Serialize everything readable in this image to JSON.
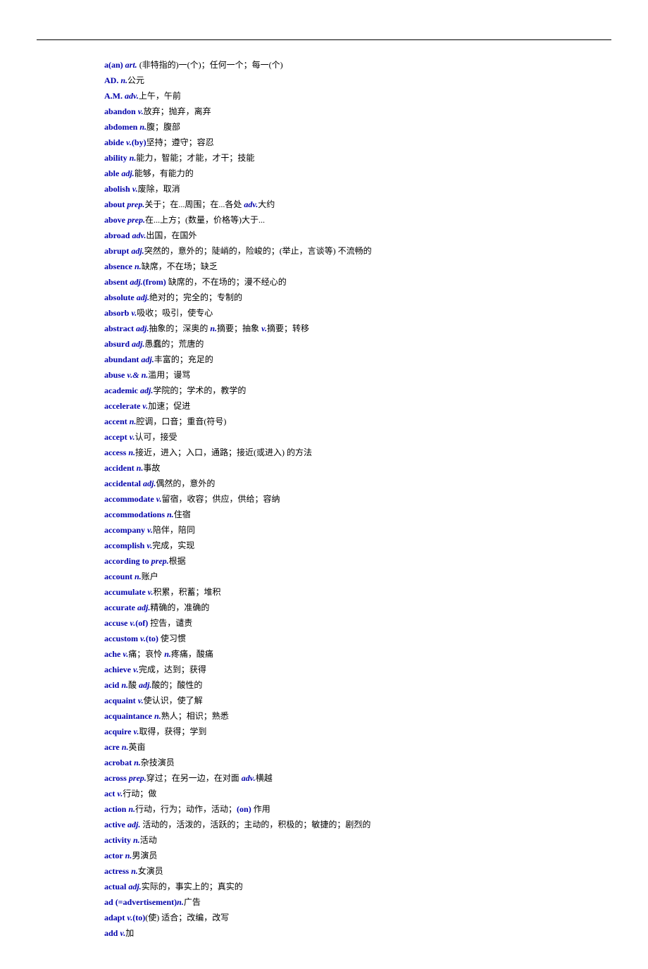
{
  "entries": [
    {
      "parts": [
        {
          "t": "hw",
          "v": "a(an)"
        },
        {
          "t": "sp"
        },
        {
          "t": "pos",
          "v": "art."
        },
        {
          "t": "sp"
        },
        {
          "t": "def",
          "v": "(非特指的)一(个)；任何一个；每一(个)"
        }
      ]
    },
    {
      "parts": [
        {
          "t": "hw",
          "v": "AD."
        },
        {
          "t": "sp"
        },
        {
          "t": "pos",
          "v": "n."
        },
        {
          "t": "def",
          "v": "公元"
        }
      ]
    },
    {
      "parts": [
        {
          "t": "hw",
          "v": "A.M."
        },
        {
          "t": "sp"
        },
        {
          "t": "pos",
          "v": "adv."
        },
        {
          "t": "def",
          "v": "上午，午前"
        }
      ]
    },
    {
      "parts": [
        {
          "t": "hw",
          "v": "abandon"
        },
        {
          "t": "sp"
        },
        {
          "t": "pos",
          "v": "v."
        },
        {
          "t": "def",
          "v": "放弃；抛弃，离弃"
        }
      ]
    },
    {
      "parts": [
        {
          "t": "hw",
          "v": "abdomen"
        },
        {
          "t": "sp"
        },
        {
          "t": "pos",
          "v": "n."
        },
        {
          "t": "def",
          "v": "腹；腹部"
        }
      ]
    },
    {
      "parts": [
        {
          "t": "hw",
          "v": "abide"
        },
        {
          "t": "sp"
        },
        {
          "t": "pos",
          "v": "v."
        },
        {
          "t": "hw",
          "v": "(by)"
        },
        {
          "t": "def",
          "v": "坚持；遵守；容忍"
        }
      ]
    },
    {
      "parts": [
        {
          "t": "hw",
          "v": "ability"
        },
        {
          "t": "sp"
        },
        {
          "t": "pos",
          "v": "n."
        },
        {
          "t": "def",
          "v": "能力，智能；才能，才干；技能"
        }
      ]
    },
    {
      "parts": [
        {
          "t": "hw",
          "v": "able"
        },
        {
          "t": "sp"
        },
        {
          "t": "pos",
          "v": "adj."
        },
        {
          "t": "def",
          "v": "能够，有能力的"
        }
      ]
    },
    {
      "parts": [
        {
          "t": "hw",
          "v": "abolish"
        },
        {
          "t": "sp"
        },
        {
          "t": "pos",
          "v": "v."
        },
        {
          "t": "def",
          "v": "废除，取消"
        }
      ]
    },
    {
      "parts": [
        {
          "t": "hw",
          "v": "about"
        },
        {
          "t": "sp"
        },
        {
          "t": "pos",
          "v": "prep."
        },
        {
          "t": "def",
          "v": "关于；在...周围；在...各处 "
        },
        {
          "t": "pos",
          "v": "adv."
        },
        {
          "t": "def",
          "v": "大约"
        }
      ]
    },
    {
      "parts": [
        {
          "t": "hw",
          "v": "above"
        },
        {
          "t": "sp"
        },
        {
          "t": "pos",
          "v": "prep."
        },
        {
          "t": "def",
          "v": "在...上方；(数量，价格等)大于..."
        }
      ]
    },
    {
      "parts": [
        {
          "t": "hw",
          "v": "abroad"
        },
        {
          "t": "sp"
        },
        {
          "t": "pos",
          "v": "adv."
        },
        {
          "t": "def",
          "v": "出国，在国外"
        }
      ]
    },
    {
      "parts": [
        {
          "t": "hw",
          "v": "abrupt"
        },
        {
          "t": "sp"
        },
        {
          "t": "pos",
          "v": "adj."
        },
        {
          "t": "def",
          "v": "突然的，意外的；陡峭的，险峻的；(举止，言谈等) 不流畅的"
        }
      ]
    },
    {
      "parts": [
        {
          "t": "hw",
          "v": "absence"
        },
        {
          "t": "sp"
        },
        {
          "t": "pos",
          "v": "n."
        },
        {
          "t": "def",
          "v": "缺席，不在场；缺乏"
        }
      ]
    },
    {
      "parts": [
        {
          "t": "hw",
          "v": "absent"
        },
        {
          "t": "sp"
        },
        {
          "t": "pos",
          "v": "adj."
        },
        {
          "t": "hw",
          "v": "(from)"
        },
        {
          "t": "def",
          "v": " 缺席的，不在场的；漫不经心的"
        }
      ]
    },
    {
      "parts": [
        {
          "t": "hw",
          "v": "absolute"
        },
        {
          "t": "sp"
        },
        {
          "t": "pos",
          "v": "adj."
        },
        {
          "t": "def",
          "v": "绝对的；完全的；专制的"
        }
      ]
    },
    {
      "parts": [
        {
          "t": "hw",
          "v": "absorb"
        },
        {
          "t": "sp"
        },
        {
          "t": "pos",
          "v": "v."
        },
        {
          "t": "def",
          "v": "吸收；吸引，使专心"
        }
      ]
    },
    {
      "parts": [
        {
          "t": "hw",
          "v": "abstract"
        },
        {
          "t": "sp"
        },
        {
          "t": "pos",
          "v": "adj."
        },
        {
          "t": "def",
          "v": "抽象的；深奥的 "
        },
        {
          "t": "pos",
          "v": "n."
        },
        {
          "t": "def",
          "v": "摘要；抽象 "
        },
        {
          "t": "pos",
          "v": "v."
        },
        {
          "t": "def",
          "v": "摘要；转移"
        }
      ]
    },
    {
      "parts": [
        {
          "t": "hw",
          "v": "absurd"
        },
        {
          "t": "sp"
        },
        {
          "t": "pos",
          "v": "adj."
        },
        {
          "t": "def",
          "v": "愚蠢的；荒唐的"
        }
      ]
    },
    {
      "parts": [
        {
          "t": "hw",
          "v": "abundant"
        },
        {
          "t": "sp"
        },
        {
          "t": "pos",
          "v": "adj."
        },
        {
          "t": "def",
          "v": "丰富的；充足的"
        }
      ]
    },
    {
      "parts": [
        {
          "t": "hw",
          "v": "abuse"
        },
        {
          "t": "sp"
        },
        {
          "t": "pos",
          "v": "v.&"
        },
        {
          "t": "sp"
        },
        {
          "t": "pos",
          "v": "n."
        },
        {
          "t": "def",
          "v": "滥用；谩骂"
        }
      ]
    },
    {
      "parts": [
        {
          "t": "hw",
          "v": "academic"
        },
        {
          "t": "sp"
        },
        {
          "t": "pos",
          "v": "adj."
        },
        {
          "t": "def",
          "v": "学院的；学术的，教学的"
        }
      ]
    },
    {
      "parts": [
        {
          "t": "hw",
          "v": "accelerate"
        },
        {
          "t": "sp"
        },
        {
          "t": "pos",
          "v": "v."
        },
        {
          "t": "def",
          "v": "加速；促进"
        }
      ]
    },
    {
      "parts": [
        {
          "t": "hw",
          "v": "accent"
        },
        {
          "t": "sp"
        },
        {
          "t": "pos",
          "v": "n."
        },
        {
          "t": "def",
          "v": "腔调，口音；重音(符号)"
        }
      ]
    },
    {
      "parts": [
        {
          "t": "hw",
          "v": "accept"
        },
        {
          "t": "sp"
        },
        {
          "t": "pos",
          "v": "v."
        },
        {
          "t": "def",
          "v": "认可，接受"
        }
      ]
    },
    {
      "parts": [
        {
          "t": "hw",
          "v": "access"
        },
        {
          "t": "sp"
        },
        {
          "t": "pos",
          "v": "n."
        },
        {
          "t": "def",
          "v": "接近，进入；入口，通路；接近(或进入) 的方法"
        }
      ]
    },
    {
      "parts": [
        {
          "t": "hw",
          "v": "accident"
        },
        {
          "t": "sp"
        },
        {
          "t": "pos",
          "v": "n."
        },
        {
          "t": "def",
          "v": "事故"
        }
      ]
    },
    {
      "parts": [
        {
          "t": "hw",
          "v": "accidental"
        },
        {
          "t": "sp"
        },
        {
          "t": "pos",
          "v": "adj."
        },
        {
          "t": "def",
          "v": "偶然的，意外的"
        }
      ]
    },
    {
      "parts": [
        {
          "t": "hw",
          "v": "accommodate"
        },
        {
          "t": "sp"
        },
        {
          "t": "pos",
          "v": "v."
        },
        {
          "t": "def",
          "v": "留宿，收容；供应，供给；容纳"
        }
      ]
    },
    {
      "parts": [
        {
          "t": "hw",
          "v": "accommodations"
        },
        {
          "t": "sp"
        },
        {
          "t": "pos",
          "v": "n."
        },
        {
          "t": "def",
          "v": "住宿"
        }
      ]
    },
    {
      "parts": [
        {
          "t": "hw",
          "v": "accompany"
        },
        {
          "t": "sp"
        },
        {
          "t": "pos",
          "v": "v."
        },
        {
          "t": "def",
          "v": "陪伴，陪同"
        }
      ]
    },
    {
      "parts": [
        {
          "t": "hw",
          "v": "accomplish"
        },
        {
          "t": "sp"
        },
        {
          "t": "pos",
          "v": "v."
        },
        {
          "t": "def",
          "v": "完成，实现"
        }
      ]
    },
    {
      "parts": [
        {
          "t": "hw",
          "v": "according to"
        },
        {
          "t": "sp"
        },
        {
          "t": "pos",
          "v": "prep."
        },
        {
          "t": "def",
          "v": "根据"
        }
      ]
    },
    {
      "parts": [
        {
          "t": "hw",
          "v": "account"
        },
        {
          "t": "sp"
        },
        {
          "t": "pos",
          "v": "n."
        },
        {
          "t": "def",
          "v": "账户"
        }
      ]
    },
    {
      "parts": [
        {
          "t": "hw",
          "v": "accumulate"
        },
        {
          "t": "sp"
        },
        {
          "t": "pos",
          "v": "v."
        },
        {
          "t": "def",
          "v": "积累，积蓄；堆积"
        }
      ]
    },
    {
      "parts": [
        {
          "t": "hw",
          "v": "accurate"
        },
        {
          "t": "sp"
        },
        {
          "t": "pos",
          "v": "adj."
        },
        {
          "t": "def",
          "v": "精确的，准确的"
        }
      ]
    },
    {
      "parts": [
        {
          "t": "hw",
          "v": "accuse"
        },
        {
          "t": "sp"
        },
        {
          "t": "pos",
          "v": "v."
        },
        {
          "t": "hw",
          "v": "(of)"
        },
        {
          "t": "def",
          "v": " 控告，谴责"
        }
      ]
    },
    {
      "parts": [
        {
          "t": "hw",
          "v": "accustom"
        },
        {
          "t": "sp"
        },
        {
          "t": "pos",
          "v": "v."
        },
        {
          "t": "hw",
          "v": "(to)"
        },
        {
          "t": "def",
          "v": " 使习惯"
        }
      ]
    },
    {
      "parts": [
        {
          "t": "hw",
          "v": "ache"
        },
        {
          "t": "sp"
        },
        {
          "t": "pos",
          "v": "v."
        },
        {
          "t": "def",
          "v": "痛；哀怜 "
        },
        {
          "t": "pos",
          "v": "n."
        },
        {
          "t": "def",
          "v": "疼痛，酸痛"
        }
      ]
    },
    {
      "parts": [
        {
          "t": "hw",
          "v": "achieve"
        },
        {
          "t": "sp"
        },
        {
          "t": "pos",
          "v": "v."
        },
        {
          "t": "def",
          "v": "完成，达到；获得"
        }
      ]
    },
    {
      "parts": [
        {
          "t": "hw",
          "v": "acid"
        },
        {
          "t": "sp"
        },
        {
          "t": "pos",
          "v": "n."
        },
        {
          "t": "def",
          "v": "酸 "
        },
        {
          "t": "pos",
          "v": "adj."
        },
        {
          "t": "def",
          "v": "酸的；酸性的"
        }
      ]
    },
    {
      "parts": [
        {
          "t": "hw",
          "v": "acquaint"
        },
        {
          "t": "sp"
        },
        {
          "t": "pos",
          "v": "v."
        },
        {
          "t": "def",
          "v": "使认识，使了解"
        }
      ]
    },
    {
      "parts": [
        {
          "t": "hw",
          "v": "acquaintance"
        },
        {
          "t": "sp"
        },
        {
          "t": "pos",
          "v": "n."
        },
        {
          "t": "def",
          "v": "熟人；相识；熟悉"
        }
      ]
    },
    {
      "parts": [
        {
          "t": "hw",
          "v": "acquire"
        },
        {
          "t": "sp"
        },
        {
          "t": "pos",
          "v": "v."
        },
        {
          "t": "def",
          "v": "取得，获得；学到"
        }
      ]
    },
    {
      "parts": [
        {
          "t": "hw",
          "v": "acre"
        },
        {
          "t": "sp"
        },
        {
          "t": "pos",
          "v": "n."
        },
        {
          "t": "def",
          "v": "英亩"
        }
      ]
    },
    {
      "parts": [
        {
          "t": "hw",
          "v": "acrobat"
        },
        {
          "t": "sp"
        },
        {
          "t": "pos",
          "v": "n."
        },
        {
          "t": "def",
          "v": "杂技演员"
        }
      ]
    },
    {
      "parts": [
        {
          "t": "hw",
          "v": "across"
        },
        {
          "t": "sp"
        },
        {
          "t": "pos",
          "v": "prep."
        },
        {
          "t": "def",
          "v": "穿过；在另一边，在对面 "
        },
        {
          "t": "pos",
          "v": "adv."
        },
        {
          "t": "def",
          "v": "横越"
        }
      ]
    },
    {
      "parts": [
        {
          "t": "hw",
          "v": "act"
        },
        {
          "t": "sp"
        },
        {
          "t": "pos",
          "v": "v."
        },
        {
          "t": "def",
          "v": "行动；做"
        }
      ]
    },
    {
      "parts": [
        {
          "t": "hw",
          "v": "action"
        },
        {
          "t": "sp"
        },
        {
          "t": "pos",
          "v": "n."
        },
        {
          "t": "def",
          "v": "行动，行为；动作，活动；"
        },
        {
          "t": "hw",
          "v": "(on)"
        },
        {
          "t": "def",
          "v": " 作用"
        }
      ]
    },
    {
      "parts": [
        {
          "t": "hw",
          "v": "active"
        },
        {
          "t": "sp"
        },
        {
          "t": "pos",
          "v": "adj."
        },
        {
          "t": "def",
          "v": " 活动的，活泼的，活跃的；主动的，积极的；敏捷的；剧烈的"
        }
      ]
    },
    {
      "parts": [
        {
          "t": "hw",
          "v": "activity"
        },
        {
          "t": "sp"
        },
        {
          "t": "pos",
          "v": "n."
        },
        {
          "t": "def",
          "v": "活动"
        }
      ]
    },
    {
      "parts": [
        {
          "t": "hw",
          "v": "actor"
        },
        {
          "t": "sp"
        },
        {
          "t": "pos",
          "v": "n."
        },
        {
          "t": "def",
          "v": "男演员"
        }
      ]
    },
    {
      "parts": [
        {
          "t": "hw",
          "v": "actress"
        },
        {
          "t": "sp"
        },
        {
          "t": "pos",
          "v": "n."
        },
        {
          "t": "def",
          "v": "女演员"
        }
      ]
    },
    {
      "parts": [
        {
          "t": "hw",
          "v": "actual"
        },
        {
          "t": "sp"
        },
        {
          "t": "pos",
          "v": "adj."
        },
        {
          "t": "def",
          "v": "实际的，事实上的；真实的"
        }
      ]
    },
    {
      "parts": [
        {
          "t": "hw",
          "v": "ad"
        },
        {
          "t": "sp"
        },
        {
          "t": "hw",
          "v": "(=advertisement)"
        },
        {
          "t": "pos",
          "v": "n."
        },
        {
          "t": "def",
          "v": "广告"
        }
      ]
    },
    {
      "parts": [
        {
          "t": "hw",
          "v": "adapt"
        },
        {
          "t": "sp"
        },
        {
          "t": "pos",
          "v": "v."
        },
        {
          "t": "hw",
          "v": "(to)"
        },
        {
          "t": "def",
          "v": "(使) 适合；改编，改写"
        }
      ]
    },
    {
      "parts": [
        {
          "t": "hw",
          "v": "add"
        },
        {
          "t": "sp"
        },
        {
          "t": "pos",
          "v": "v."
        },
        {
          "t": "def",
          "v": "加"
        }
      ]
    }
  ]
}
